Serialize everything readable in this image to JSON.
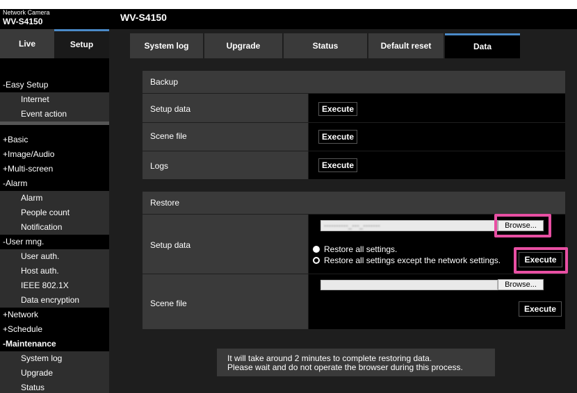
{
  "header": {
    "brand_line1": "Network Camera",
    "brand_line2": "WV-S4150",
    "model_title": "WV-S4150"
  },
  "mode_tabs": {
    "live": "Live",
    "setup": "Setup"
  },
  "sidebar": {
    "easy_setup": "-Easy Setup",
    "internet": "Internet",
    "event_action": "Event action",
    "basic": "+Basic",
    "image_audio": "+Image/Audio",
    "multi_screen": "+Multi-screen",
    "alarm_group": "-Alarm",
    "alarm": "Alarm",
    "people_count": "People count",
    "notification": "Notification",
    "user_mng": "-User mng.",
    "user_auth": "User auth.",
    "host_auth": "Host auth.",
    "ieee": "IEEE 802.1X",
    "data_encryption": "Data encryption",
    "network": "+Network",
    "schedule": "+Schedule",
    "maintenance": "-Maintenance",
    "system_log": "System log",
    "upgrade": "Upgrade",
    "status": "Status"
  },
  "tabs": {
    "system_log": "System log",
    "upgrade": "Upgrade",
    "status": "Status",
    "default_reset": "Default reset",
    "data": "Data"
  },
  "backup": {
    "header": "Backup",
    "setup_data_label": "Setup data",
    "scene_file_label": "Scene file",
    "logs_label": "Logs",
    "execute": "Execute"
  },
  "restore": {
    "header": "Restore",
    "setup_data_label": "Setup data",
    "scene_file_label": "Scene file",
    "file_name": "----------_---_-------",
    "browse": "Browse...",
    "radio_all": "Restore all settings.",
    "radio_except_network": "Restore all settings except the network settings.",
    "execute": "Execute"
  },
  "notice": {
    "line1": "It will take around 2 minutes to complete restoring data.",
    "line2": "Please wait and do not operate the browser during this process."
  },
  "colors": {
    "highlight": "#e84fa3",
    "active_tab_accent": "#4a8ac8"
  }
}
